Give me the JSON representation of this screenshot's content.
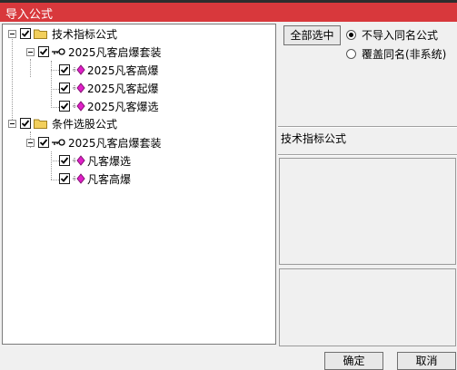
{
  "window": {
    "title": "导入公式"
  },
  "tree": {
    "groups": [
      {
        "label": "技术指标公式",
        "package": {
          "label": "2025凡客启爆套装",
          "items": [
            {
              "label": "2025凡客高爆"
            },
            {
              "label": "2025凡客起爆"
            },
            {
              "label": "2025凡客爆选"
            }
          ]
        }
      },
      {
        "label": "条件选股公式",
        "package": {
          "label": "2025凡客启爆套装",
          "items": [
            {
              "label": "凡客爆选"
            },
            {
              "label": "凡客高爆"
            }
          ]
        }
      }
    ]
  },
  "options": {
    "select_all_label": "全部选中",
    "radio_no_import_label": "不导入同名公式",
    "radio_overwrite_label": "覆盖同名(非系统)",
    "selected": "no_import"
  },
  "info": {
    "category_label": "技术指标公式"
  },
  "footer": {
    "ok_label": "确定",
    "cancel_label": "取消"
  },
  "colors": {
    "titlebar": "#d8383c",
    "folder": "#f2cf5c",
    "diamond": "#e020c8"
  }
}
